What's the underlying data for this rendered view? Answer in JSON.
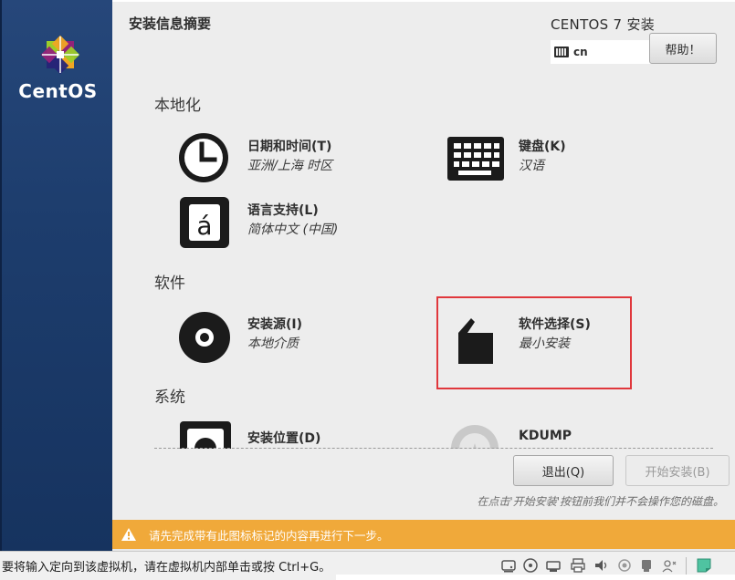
{
  "sidebar": {
    "logo_text": "CentOS"
  },
  "header": {
    "page_title": "安装信息摘要",
    "product_title": "CENTOS 7 安装",
    "keyboard_layout": "cn",
    "help_label": "帮助！"
  },
  "sections": {
    "localization": "本地化",
    "software": "软件",
    "system": "系统"
  },
  "spokes": {
    "datetime": {
      "title": "日期和时间(T)",
      "status": "亚洲/上海 时区",
      "icon": "clock-icon"
    },
    "keyboard": {
      "title": "键盘(K)",
      "status": "汉语",
      "icon": "keyboard-icon"
    },
    "language": {
      "title": "语言支持(L)",
      "status": "简体中文 (中国)",
      "icon": "language-icon"
    },
    "source": {
      "title": "安装源(I)",
      "status": "本地介质",
      "icon": "disc-icon"
    },
    "software": {
      "title": "软件选择(S)",
      "status": "最小安装",
      "icon": "package-icon"
    },
    "destination": {
      "title": "安装位置(D)",
      "icon": "harddisk-icon"
    },
    "kdump": {
      "title": "KDUMP",
      "icon": "kdump-icon"
    }
  },
  "footer": {
    "quit_label": "退出(Q)",
    "begin_label": "开始安装(B)",
    "hint": "在点击'开始安装'按钮前我们并不会操作您的磁盘。"
  },
  "warning": {
    "text": "请先完成带有此图标标记的内容再进行下一步。"
  },
  "vm_status": {
    "hint": "要将输入定向到该虚拟机，请在虚拟机内部单击或按 Ctrl+G。"
  },
  "colors": {
    "warning_bar": "#f0a93a",
    "highlight": "#e0373c",
    "sidebar": "#1d3d6d"
  }
}
